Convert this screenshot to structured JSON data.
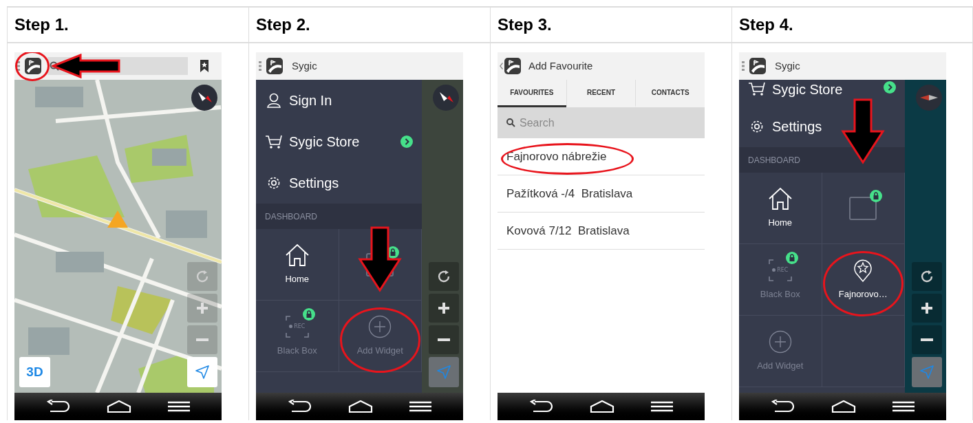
{
  "steps": [
    {
      "title": "Step 1.",
      "screen": {
        "kind": "map",
        "logo_circled": true,
        "logo_arrow": true,
        "button_3d": "3D"
      }
    },
    {
      "title": "Step 2.",
      "screen": {
        "kind": "menu",
        "app_title": "Sygic",
        "map": {
          "kind": "city"
        },
        "scrolled": false,
        "section": "DASHBOARD",
        "items": [
          {
            "kind": "user",
            "label": "Sign In",
            "badge": false
          },
          {
            "kind": "cart",
            "label": "Sygic Store",
            "badge": true
          },
          {
            "kind": "gear",
            "label": "Settings",
            "badge": false
          }
        ],
        "widgets": [
          {
            "kind": "home",
            "label": "Home",
            "locked": false,
            "disabled": false,
            "circled": false,
            "arrow": false
          },
          {
            "kind": "partial",
            "locked": true,
            "disabled": false,
            "circled": false,
            "arrow": false
          },
          {
            "kind": "recorder",
            "icon_text": "REC",
            "label": "Black Box",
            "locked": true,
            "disabled": true,
            "circled": false,
            "arrow": false
          },
          {
            "kind": "plus",
            "label": "Add Widget",
            "locked": false,
            "disabled": true,
            "circled": true,
            "arrow": true
          }
        ]
      }
    },
    {
      "title": "Step 3.",
      "screen": {
        "kind": "favourites",
        "app_title": "Add Favourite",
        "tabs": [
          {
            "label": "FAVOURITES",
            "selected": true
          },
          {
            "label": "RECENT",
            "selected": false
          },
          {
            "label": "CONTACTS",
            "selected": false
          }
        ],
        "search": {
          "placeholder": "Search"
        },
        "results": [
          {
            "label": "Fajnorovo nábrežie",
            "circled": true
          },
          {
            "label": "Pažítková -/4  Bratislava",
            "circled": false
          },
          {
            "label": "Kovová 7/12  Bratislava",
            "circled": false
          }
        ]
      }
    },
    {
      "title": "Step 4.",
      "screen": {
        "kind": "menu",
        "app_title": "Sygic",
        "map": {
          "kind": "water"
        },
        "scrolled": true,
        "section": "DASHBOARD",
        "items": [
          {
            "kind": "cart",
            "label": "Sygic Store",
            "badge": true
          },
          {
            "kind": "gear",
            "label": "Settings",
            "badge": false
          }
        ],
        "widgets": [
          {
            "kind": "home",
            "label": "Home",
            "locked": false,
            "disabled": false,
            "circled": false,
            "arrow": false
          },
          {
            "kind": "partial",
            "locked": true,
            "disabled": false,
            "circled": false,
            "arrow": true
          },
          {
            "kind": "recorder",
            "icon_text": "REC",
            "label": "Black Box",
            "locked": true,
            "disabled": true,
            "circled": false,
            "arrow": false
          },
          {
            "kind": "star-pin",
            "label": "Fajnorovo…",
            "locked": false,
            "disabled": false,
            "circled": true,
            "arrow": false
          },
          {
            "kind": "plus",
            "label": "Add Widget",
            "locked": false,
            "disabled": true,
            "circled": false,
            "arrow": false
          }
        ]
      }
    }
  ]
}
